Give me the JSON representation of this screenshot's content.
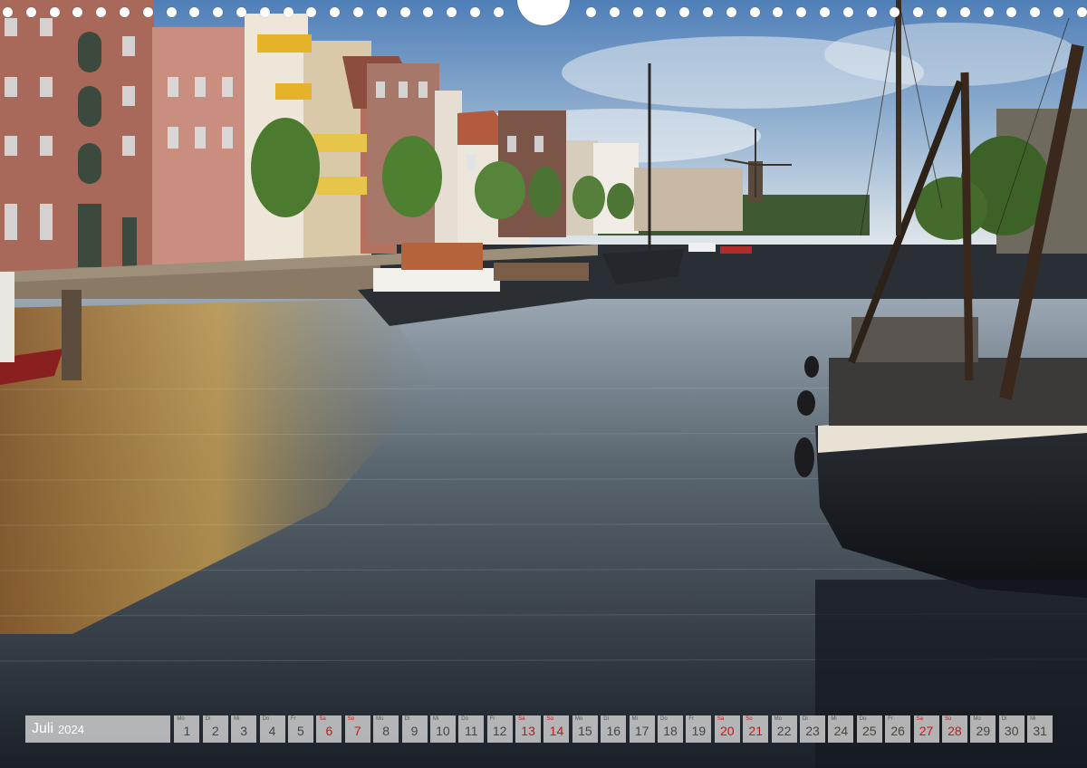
{
  "photo": {
    "subject": "canal-harbour-with-moored-boats-and-windmill"
  },
  "calendar": {
    "month": "Juli",
    "year": "2024",
    "weekend_color": "#c21a1a",
    "days": [
      {
        "dow": "Mo",
        "num": "1",
        "weekend": false
      },
      {
        "dow": "Di",
        "num": "2",
        "weekend": false
      },
      {
        "dow": "Mi",
        "num": "3",
        "weekend": false
      },
      {
        "dow": "Do",
        "num": "4",
        "weekend": false
      },
      {
        "dow": "Fr",
        "num": "5",
        "weekend": false
      },
      {
        "dow": "Sa",
        "num": "6",
        "weekend": true
      },
      {
        "dow": "So",
        "num": "7",
        "weekend": true
      },
      {
        "dow": "Mo",
        "num": "8",
        "weekend": false
      },
      {
        "dow": "Di",
        "num": "9",
        "weekend": false
      },
      {
        "dow": "Mi",
        "num": "10",
        "weekend": false
      },
      {
        "dow": "Do",
        "num": "11",
        "weekend": false
      },
      {
        "dow": "Fr",
        "num": "12",
        "weekend": false
      },
      {
        "dow": "Sa",
        "num": "13",
        "weekend": true
      },
      {
        "dow": "So",
        "num": "14",
        "weekend": true
      },
      {
        "dow": "Mo",
        "num": "15",
        "weekend": false
      },
      {
        "dow": "Di",
        "num": "16",
        "weekend": false
      },
      {
        "dow": "Mi",
        "num": "17",
        "weekend": false
      },
      {
        "dow": "Do",
        "num": "18",
        "weekend": false
      },
      {
        "dow": "Fr",
        "num": "19",
        "weekend": false
      },
      {
        "dow": "Sa",
        "num": "20",
        "weekend": true
      },
      {
        "dow": "So",
        "num": "21",
        "weekend": true
      },
      {
        "dow": "Mo",
        "num": "22",
        "weekend": false
      },
      {
        "dow": "Di",
        "num": "23",
        "weekend": false
      },
      {
        "dow": "Mi",
        "num": "24",
        "weekend": false
      },
      {
        "dow": "Do",
        "num": "25",
        "weekend": false
      },
      {
        "dow": "Fr",
        "num": "26",
        "weekend": false
      },
      {
        "dow": "Sa",
        "num": "27",
        "weekend": true
      },
      {
        "dow": "So",
        "num": "28",
        "weekend": true
      },
      {
        "dow": "Mo",
        "num": "29",
        "weekend": false
      },
      {
        "dow": "Di",
        "num": "30",
        "weekend": false
      },
      {
        "dow": "Mi",
        "num": "31",
        "weekend": false
      }
    ]
  }
}
